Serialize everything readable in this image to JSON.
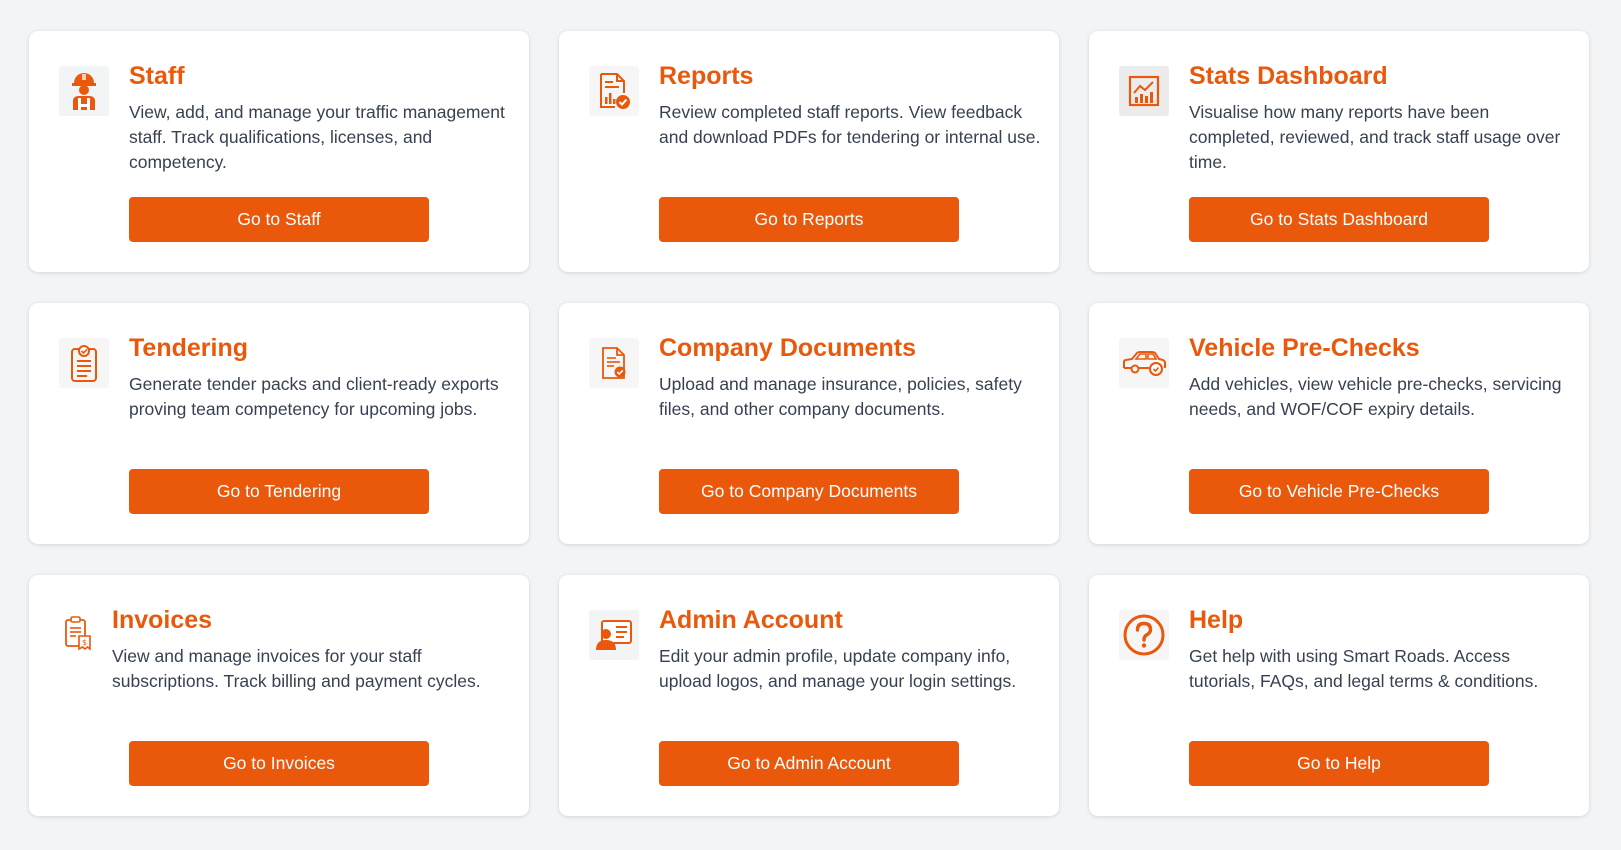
{
  "colors": {
    "accent": "#ea580c",
    "background": "#f3f4f6",
    "card": "#ffffff",
    "text": "#374151"
  },
  "cards": [
    {
      "icon": "worker-hardhat-icon",
      "title": "Staff",
      "description": "View, add, and manage your traffic management staff. Track qualifications, licenses, and competency.",
      "button": "Go to Staff"
    },
    {
      "icon": "report-check-icon",
      "title": "Reports",
      "description": "Review completed staff reports. View feedback and download PDFs for tendering or internal use.",
      "button": "Go to Reports"
    },
    {
      "icon": "stats-chart-icon",
      "title": "Stats Dashboard",
      "description": "Visualise how many reports have been completed, reviewed, and track staff usage over time.",
      "button": "Go to Stats Dashboard"
    },
    {
      "icon": "clipboard-check-icon",
      "title": "Tendering",
      "description": "Generate tender packs and client-ready exports proving team competency for upcoming jobs.",
      "button": "Go to Tendering"
    },
    {
      "icon": "document-check-icon",
      "title": "Company Documents",
      "description": "Upload and manage insurance, policies, safety files, and other company documents.",
      "button": "Go to Company Documents"
    },
    {
      "icon": "car-check-icon",
      "title": "Vehicle Pre-Checks",
      "description": "Add vehicles, view vehicle pre-checks, servicing needs, and WOF/COF expiry details.",
      "button": "Go to Vehicle Pre-Checks"
    },
    {
      "icon": "invoice-clipboard-icon",
      "title": "Invoices",
      "description": "View and manage invoices for your staff subscriptions. Track billing and payment cycles.",
      "button": "Go to Invoices"
    },
    {
      "icon": "admin-user-icon",
      "title": "Admin Account",
      "description": "Edit your admin profile, update company info, upload logos, and manage your login settings.",
      "button": "Go to Admin Account"
    },
    {
      "icon": "help-question-icon",
      "title": "Help",
      "description": "Get help with using Smart Roads. Access tutorials, FAQs, and legal terms & conditions.",
      "button": "Go to Help"
    }
  ]
}
